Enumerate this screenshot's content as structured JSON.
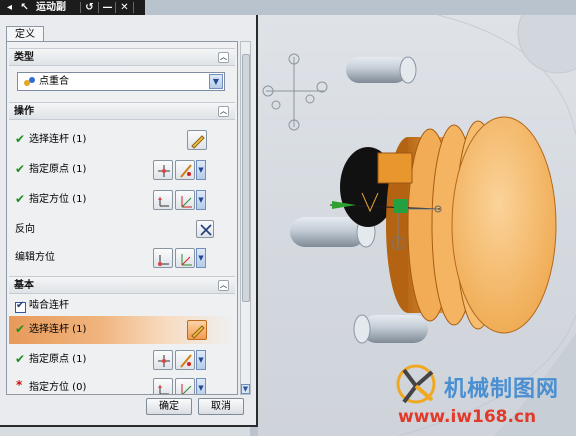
{
  "toolbar": {
    "title": "运动副",
    "icons": [
      "pointer-icon",
      "undo-icon",
      "minimize-icon",
      "close-icon"
    ]
  },
  "dialog": {
    "tab_label": "定义",
    "sections": {
      "type": {
        "header": "类型",
        "selected": "点重合"
      },
      "action": {
        "header": "操作",
        "rows": {
          "select_link": "选择连杆 (1)",
          "specify_origin": "指定原点 (1)",
          "specify_orientation": "指定方位 (1)",
          "reverse": "反向",
          "edit_orientation": "编辑方位"
        }
      },
      "base": {
        "header": "基本",
        "engage_link": "啮合连杆",
        "rows": {
          "select_link": "选择连杆 (1)",
          "specify_origin": "指定原点 (1)",
          "specify_orientation": "指定方位 (0)"
        }
      }
    },
    "ok_label": "确定",
    "cancel_label": "取消"
  },
  "watermark": {
    "brand": "机械制图网",
    "url": "www.iw168.cn"
  },
  "colors": {
    "check": "#1f8f1f",
    "required_star": "#d01010",
    "highlight": "#e79a5a",
    "part_orange": "#eea64a",
    "pin_gray": "#b9c2cc"
  }
}
